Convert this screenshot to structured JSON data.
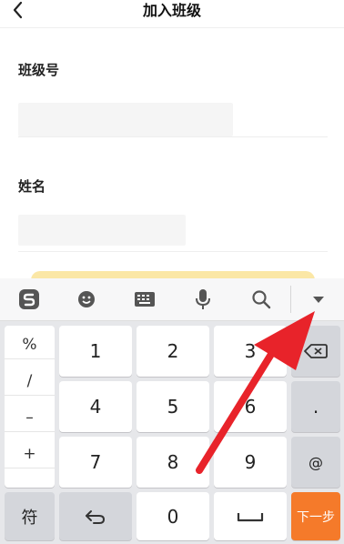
{
  "header": {
    "title": "加入班级"
  },
  "form": {
    "class_no_label": "班级号",
    "name_label": "姓名"
  },
  "keyboard": {
    "symbols": [
      "%",
      "/",
      "–",
      "+"
    ],
    "digits": [
      "1",
      "2",
      "3",
      "4",
      "5",
      "6",
      "7",
      "8",
      "9"
    ],
    "dot": ".",
    "at": "@",
    "symbol_key": "符",
    "zero": "0",
    "next": "下一步"
  },
  "colors": {
    "next_key": "#f57a2a",
    "annotation_arrow": "#e8232a"
  }
}
